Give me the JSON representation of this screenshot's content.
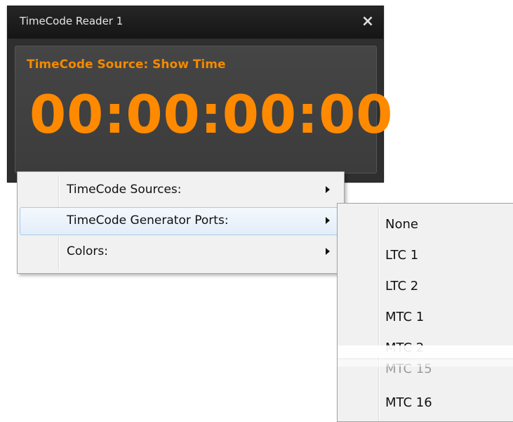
{
  "window": {
    "title": "TimeCode Reader 1",
    "close_glyph": "×",
    "source_label": "TimeCode Source: Show Time",
    "timecode": "00:00:00:00",
    "accent_color": "#ff8a00"
  },
  "context_menu": {
    "items": [
      {
        "label": "TimeCode Sources:",
        "has_submenu": true,
        "highlighted": false
      },
      {
        "label": "TimeCode Generator Ports:",
        "has_submenu": true,
        "highlighted": true
      },
      {
        "label": "Colors:",
        "has_submenu": true,
        "highlighted": false
      }
    ]
  },
  "submenu": {
    "items": [
      {
        "label": "None"
      },
      {
        "label": "LTC 1"
      },
      {
        "label": "LTC 2"
      },
      {
        "label": "MTC 1"
      },
      {
        "label": "MTC 2"
      },
      {
        "label": "MTC 15"
      },
      {
        "label": "MTC 16"
      }
    ]
  }
}
